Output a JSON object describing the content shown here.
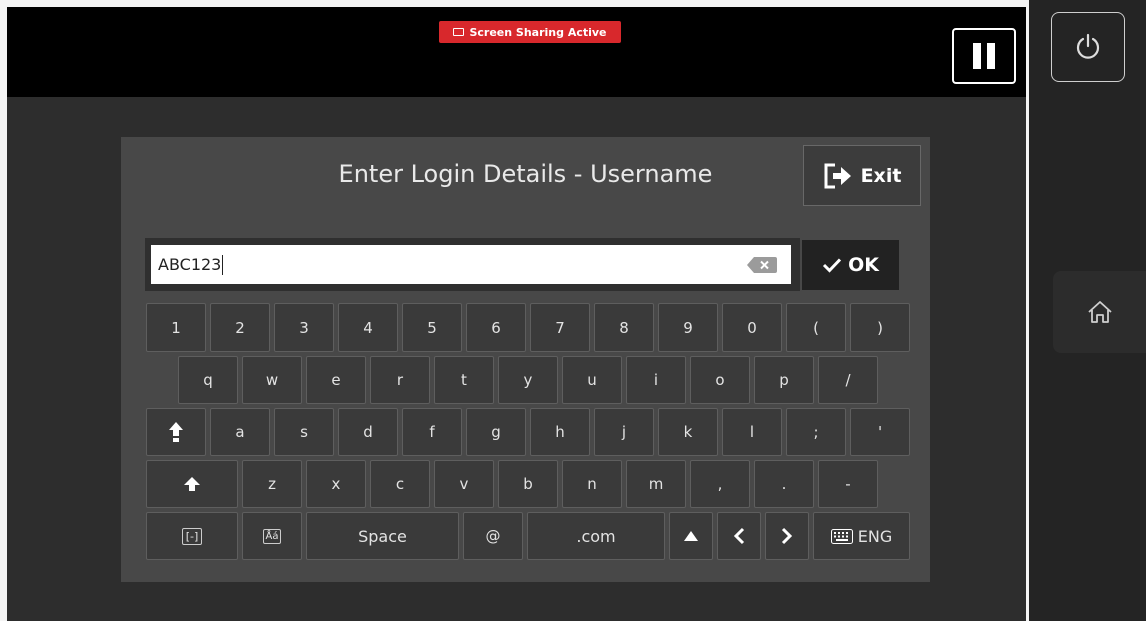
{
  "status_banner": "Screen Sharing Active",
  "dialog": {
    "title": "Enter Login Details - Username",
    "exit_label": "Exit",
    "ok_label": "OK"
  },
  "input": {
    "value": "ABC123"
  },
  "keyboard": {
    "row1": [
      "1",
      "2",
      "3",
      "4",
      "5",
      "6",
      "7",
      "8",
      "9",
      "0",
      "(",
      ")"
    ],
    "row2": [
      "q",
      "w",
      "e",
      "r",
      "t",
      "y",
      "u",
      "i",
      "o",
      "p",
      "/"
    ],
    "row3": [
      "a",
      "s",
      "d",
      "f",
      "g",
      "h",
      "j",
      "k",
      "l",
      ";",
      "'"
    ],
    "row4": [
      "z",
      "x",
      "c",
      "v",
      "b",
      "n",
      "m",
      ",",
      ".",
      "-"
    ],
    "space_label": "Space",
    "at_label": "@",
    "dotcom_label": ".com",
    "lang_label": "ENG",
    "symbol_key_label": "[-]",
    "accent_key_label": "Åá"
  },
  "colors": {
    "accent_red": "#d8282c",
    "screen_bg": "#2d2d2d",
    "dialog_bg": "#484848"
  }
}
